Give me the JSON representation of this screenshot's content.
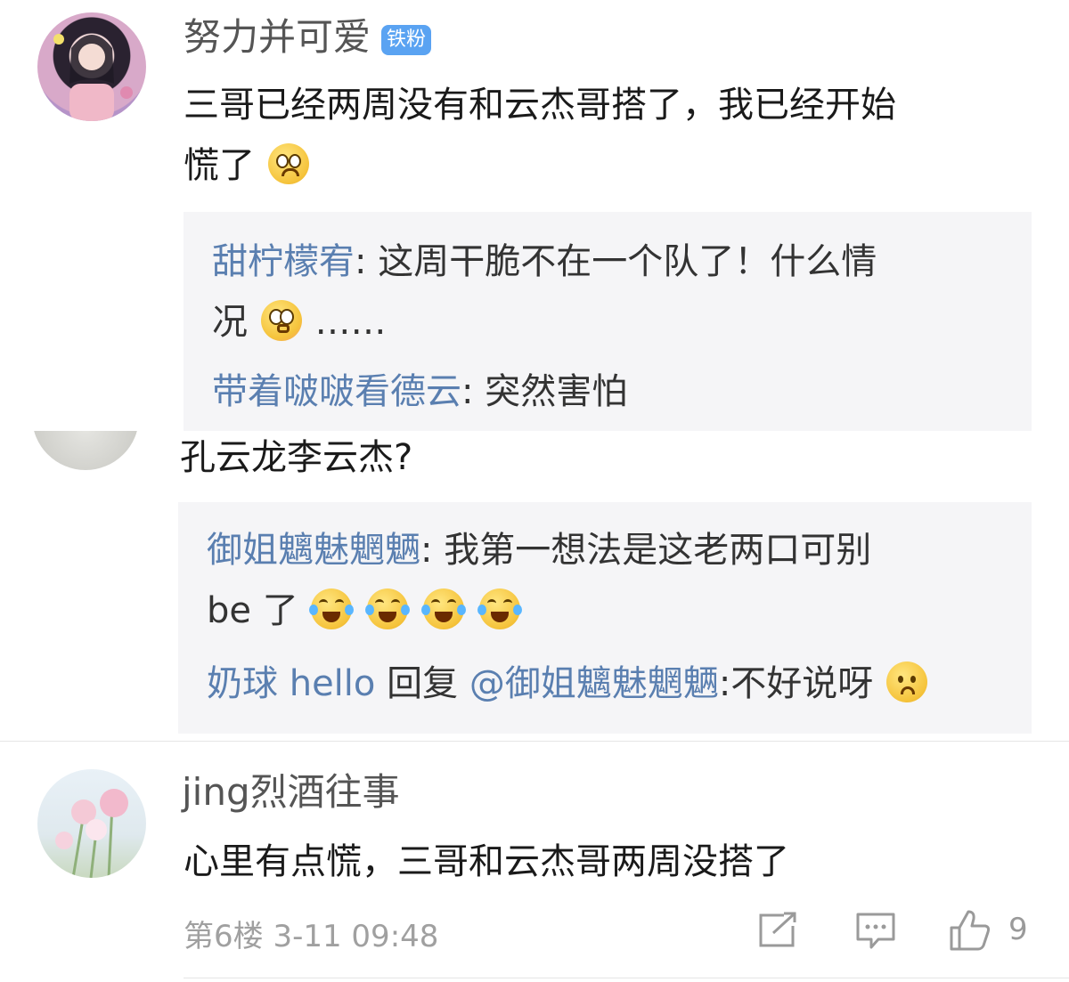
{
  "comments": [
    {
      "username": "努力并可爱",
      "badge": "铁粉",
      "text_line1": "三哥已经两周没有和云杰哥搭了，我已经开始",
      "text_line2": "慌了",
      "replies": [
        {
          "name": "甜柠檬宥",
          "text_line1": ": 这周干脆不在一个队了！什么情",
          "text_line2": "况",
          "text_suffix": "……"
        },
        {
          "name": "带着啵啵看德云",
          "text": ": 突然害怕"
        }
      ]
    },
    {
      "text": "孔云龙李云杰?",
      "replies": [
        {
          "name": "御姐魑魅魍魉",
          "text_line1": ": 我第一想法是这老两口可别",
          "text_line2": "be 了"
        },
        {
          "name": "奶球 hello",
          "reply_word": "回复",
          "mention": "@御姐魑魅魍魉",
          "text": ":不好说呀"
        }
      ]
    },
    {
      "username": "jing烈酒往事",
      "text": "心里有点慌，三哥和云杰哥两周没搭了",
      "floor": "第6楼",
      "time": "3-11 09:48",
      "like_count": "9"
    }
  ],
  "icons": {
    "share": "share-icon",
    "comment": "comment-icon",
    "like": "thumbs-up-icon"
  },
  "colors": {
    "reply_name": "#5a7fb0",
    "badge": "#5aa3f2",
    "reply_bg": "#f5f5f7"
  }
}
